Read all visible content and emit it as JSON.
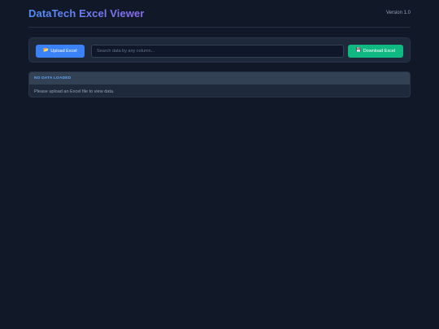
{
  "header": {
    "title": "DataTech Excel Viewer",
    "version": "Version 1.0"
  },
  "toolbar": {
    "upload_label": "Upload Excel",
    "upload_icon": "folder-icon",
    "search_placeholder": "Search data by any column...",
    "download_label": "Download Excel",
    "download_icon": "floppy-disk-icon"
  },
  "data_panel": {
    "status": "NO DATA LOADED",
    "message": "Please upload an Excel file to view data."
  },
  "colors": {
    "background": "#111827",
    "panel": "#1e293b",
    "upload_button": "#3b82f6",
    "download_button": "#10b981",
    "title_gradient_start": "#4f8ff7",
    "title_gradient_end": "#8b6cf0",
    "status_text": "#60a5fa"
  }
}
